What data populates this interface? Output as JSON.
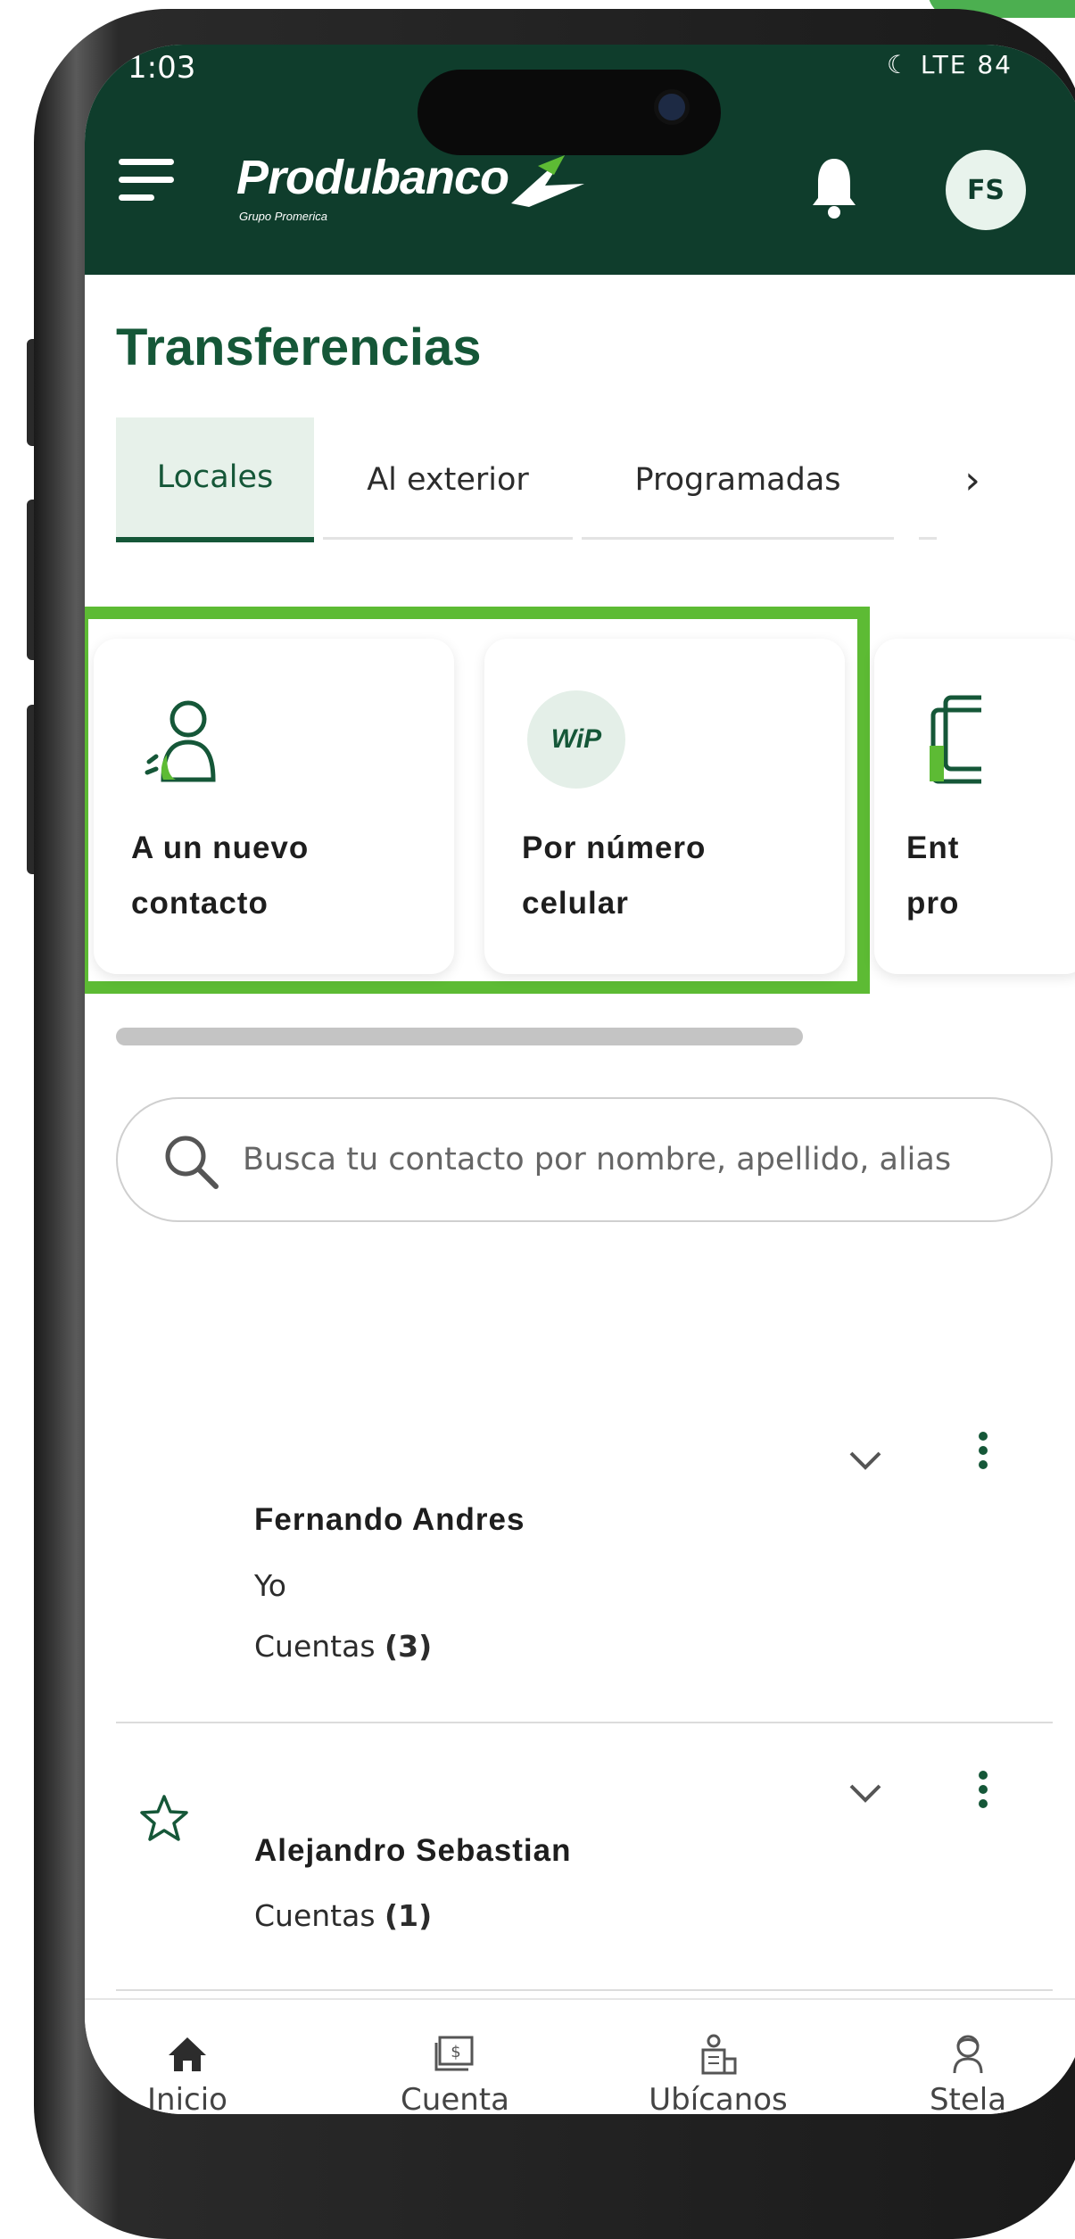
{
  "status_bar": {
    "time": "1:03",
    "icons": "☾ LTE 84"
  },
  "header": {
    "brand": "Produbanco",
    "brand_sub": "Grupo Promerica",
    "avatar_initials": "FS"
  },
  "page": {
    "title": "Transferencias"
  },
  "tabs": [
    {
      "label": "Locales",
      "active": true
    },
    {
      "label": "Al exterior",
      "active": false
    },
    {
      "label": "Programadas",
      "active": false
    }
  ],
  "cards": [
    {
      "label": "A un nuevo\ncontacto",
      "icon": "new-contact-icon"
    },
    {
      "label": "Por número\ncelular",
      "icon": "wip-icon",
      "icon_text": "WiP"
    },
    {
      "label": "Ent\npro",
      "icon": "wallet-icon"
    }
  ],
  "search": {
    "placeholder": "Busca tu contacto por nombre, apellido, alias"
  },
  "contacts": [
    {
      "name": "Fernando Andres",
      "relation": "Yo",
      "accounts_label": "Cuentas",
      "accounts_count": "(3)",
      "favorite": false
    },
    {
      "name": "Alejandro Sebastian",
      "accounts_label": "Cuentas",
      "accounts_count": "(1)",
      "favorite": false
    }
  ],
  "bottom_nav": [
    {
      "label": "Inicio",
      "icon": "home-icon"
    },
    {
      "label": "Cuenta",
      "icon": "cash-icon"
    },
    {
      "label": "Ubícanos",
      "icon": "location-building-icon"
    },
    {
      "label": "Stela",
      "icon": "assistant-icon"
    }
  ],
  "colors": {
    "header": "#0f3d2c",
    "brand_green": "#155738",
    "highlight": "#5dbb34"
  }
}
